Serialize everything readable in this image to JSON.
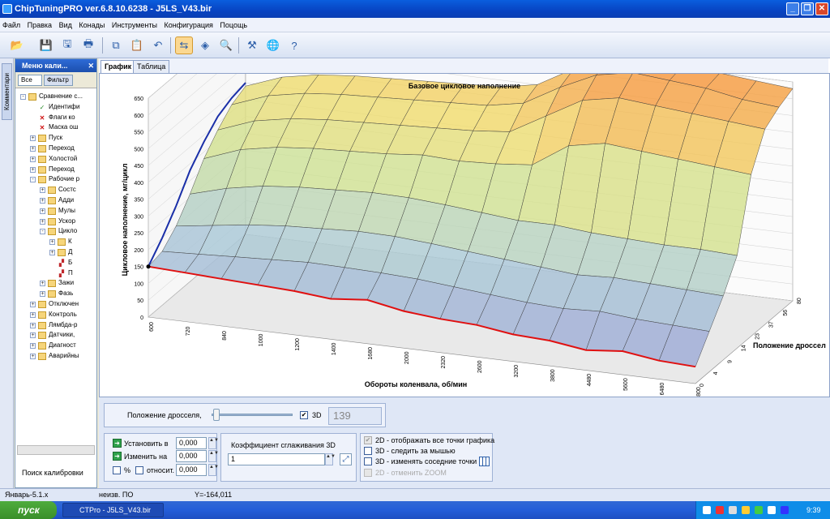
{
  "window": {
    "title": "ChipTuningPRO ver.6.8.10.6238 - J5LS_V43.bir"
  },
  "menu": [
    "Файл",
    "Правка",
    "Вид",
    "Конады",
    "Инструменты",
    "Конфигурация",
    "Поцощь"
  ],
  "side_tab": "Комментари",
  "left_panel": {
    "title": "Меню кали...",
    "close": "✕",
    "filter_all": "Все",
    "filter_btn": "Фильтр",
    "search_label": "Поиск калибровки",
    "tree": [
      {
        "label": "Сравнение с...",
        "level": 0,
        "exp": "-",
        "icon": "folder"
      },
      {
        "label": "Идентифи",
        "level": 1,
        "exp": "",
        "icon": "check"
      },
      {
        "label": "Флаги ко",
        "level": 1,
        "exp": "",
        "icon": "x"
      },
      {
        "label": "Маска ош",
        "level": 1,
        "exp": "",
        "icon": "x"
      },
      {
        "label": "Пуск",
        "level": 1,
        "exp": "+",
        "icon": "folder"
      },
      {
        "label": "Переход",
        "level": 1,
        "exp": "+",
        "icon": "folder"
      },
      {
        "label": "Холостой",
        "level": 1,
        "exp": "+",
        "icon": "folder"
      },
      {
        "label": "Переход",
        "level": 1,
        "exp": "+",
        "icon": "folder"
      },
      {
        "label": "Рабочие р",
        "level": 1,
        "exp": "-",
        "icon": "folder"
      },
      {
        "label": "Состс",
        "level": 2,
        "exp": "+",
        "icon": "folder"
      },
      {
        "label": "Адди",
        "level": 2,
        "exp": "+",
        "icon": "folder"
      },
      {
        "label": "Мулы",
        "level": 2,
        "exp": "+",
        "icon": "folder"
      },
      {
        "label": "Ускор",
        "level": 2,
        "exp": "+",
        "icon": "folder"
      },
      {
        "label": "Цикло",
        "level": 2,
        "exp": "-",
        "icon": "folder"
      },
      {
        "label": "К",
        "level": 3,
        "exp": "+",
        "icon": "folder"
      },
      {
        "label": "Д",
        "level": 3,
        "exp": "+",
        "icon": "folder"
      },
      {
        "label": "Б",
        "level": 3,
        "exp": "",
        "icon": "map"
      },
      {
        "label": "П",
        "level": 3,
        "exp": "",
        "icon": "map"
      },
      {
        "label": "Зажи",
        "level": 2,
        "exp": "+",
        "icon": "folder"
      },
      {
        "label": "Фазь",
        "level": 2,
        "exp": "+",
        "icon": "folder"
      },
      {
        "label": "Отключен",
        "level": 1,
        "exp": "+",
        "icon": "folder"
      },
      {
        "label": "Контроль",
        "level": 1,
        "exp": "+",
        "icon": "folder"
      },
      {
        "label": "Лямбда-р",
        "level": 1,
        "exp": "+",
        "icon": "folder"
      },
      {
        "label": "Датчики,",
        "level": 1,
        "exp": "+",
        "icon": "folder"
      },
      {
        "label": "Диагност",
        "level": 1,
        "exp": "+",
        "icon": "folder"
      },
      {
        "label": "Аварийны",
        "level": 1,
        "exp": "+",
        "icon": "folder"
      }
    ]
  },
  "tabs": [
    "График",
    "Таблица"
  ],
  "chart_data": {
    "type": "surface3d",
    "title": "Базовое цикловое наполнение",
    "xlabel": "Обороты коленвала, об/мин",
    "ylabel": "Цикловое наполнение, мг/цикл",
    "zlabel": "Положение дроссел",
    "rpm_ticks": [
      "600",
      "720",
      "840",
      "1000",
      "1200",
      "1400",
      "1680",
      "2000",
      "2320",
      "2600",
      "3200",
      "3800",
      "4480",
      "5600",
      "6480",
      "7800"
    ],
    "throttle_ticks": [
      "0",
      "4",
      "9",
      "14",
      "23",
      "37",
      "56",
      "80"
    ],
    "y_ticks": [
      "0",
      "50",
      "100",
      "150",
      "200",
      "250",
      "300",
      "350",
      "400",
      "450",
      "500",
      "550",
      "600",
      "650"
    ],
    "ylim": [
      0,
      650
    ],
    "surface_rows_mg": [
      [
        150,
        145,
        140,
        135,
        130,
        120,
        130,
        110,
        100,
        95,
        80,
        75,
        60,
        70,
        55,
        50
      ],
      [
        160,
        165,
        170,
        175,
        180,
        178,
        175,
        170,
        160,
        150,
        140,
        135,
        140,
        130,
        125,
        120
      ],
      [
        200,
        215,
        230,
        240,
        245,
        250,
        248,
        240,
        230,
        220,
        210,
        200,
        205,
        200,
        195,
        190
      ],
      [
        260,
        290,
        310,
        320,
        325,
        330,
        328,
        320,
        310,
        300,
        300,
        290,
        285,
        280,
        280,
        275
      ],
      [
        330,
        370,
        390,
        400,
        405,
        410,
        420,
        415,
        420,
        430,
        500,
        520,
        510,
        500,
        490,
        480
      ],
      [
        380,
        420,
        440,
        450,
        455,
        460,
        465,
        470,
        480,
        540,
        600,
        620,
        610,
        600,
        590,
        580
      ],
      [
        420,
        460,
        480,
        490,
        495,
        500,
        505,
        510,
        530,
        590,
        640,
        660,
        650,
        640,
        620,
        610
      ],
      [
        440,
        480,
        500,
        510,
        515,
        520,
        525,
        530,
        550,
        610,
        650,
        670,
        660,
        650,
        640,
        630
      ]
    ],
    "highlight_red_mg": [
      150,
      145,
      140,
      135,
      130,
      120,
      130,
      110,
      100,
      95,
      80,
      75,
      60,
      70,
      55,
      50
    ],
    "highlight_blue_mg": [
      150,
      200,
      260,
      330,
      380,
      420,
      440,
      450
    ]
  },
  "controls": {
    "throttle_label": "Положение дросселя,",
    "checkbox_3d": "3D",
    "value_readout": "139",
    "set_label": "Установить в",
    "change_label": "Изменить на",
    "set_value": "0,000",
    "change_value": "0,000",
    "rel_value": "0,000",
    "pct_label": "%",
    "rel_label": "относит.",
    "smooth_label": "Коэффициент сглаживания 3D",
    "smooth_value": "1",
    "opt1": "2D - отображать все точки графика",
    "opt2": "3D - следить за мышью",
    "opt3": "3D - изменять соседние точки",
    "opt4": "2D - отменить ZOOM"
  },
  "status": {
    "left": "Январь-5.1.х",
    "mid": "неизв. ПО",
    "y": "Y=-164,011"
  },
  "taskbar": {
    "start": "пуск",
    "item": "CTPro - J5LS_V43.bir",
    "clock": "9:39"
  },
  "colors": {
    "accent": "#0a5ede",
    "red_line": "#e01010",
    "blue_line": "#1a2fa8"
  }
}
